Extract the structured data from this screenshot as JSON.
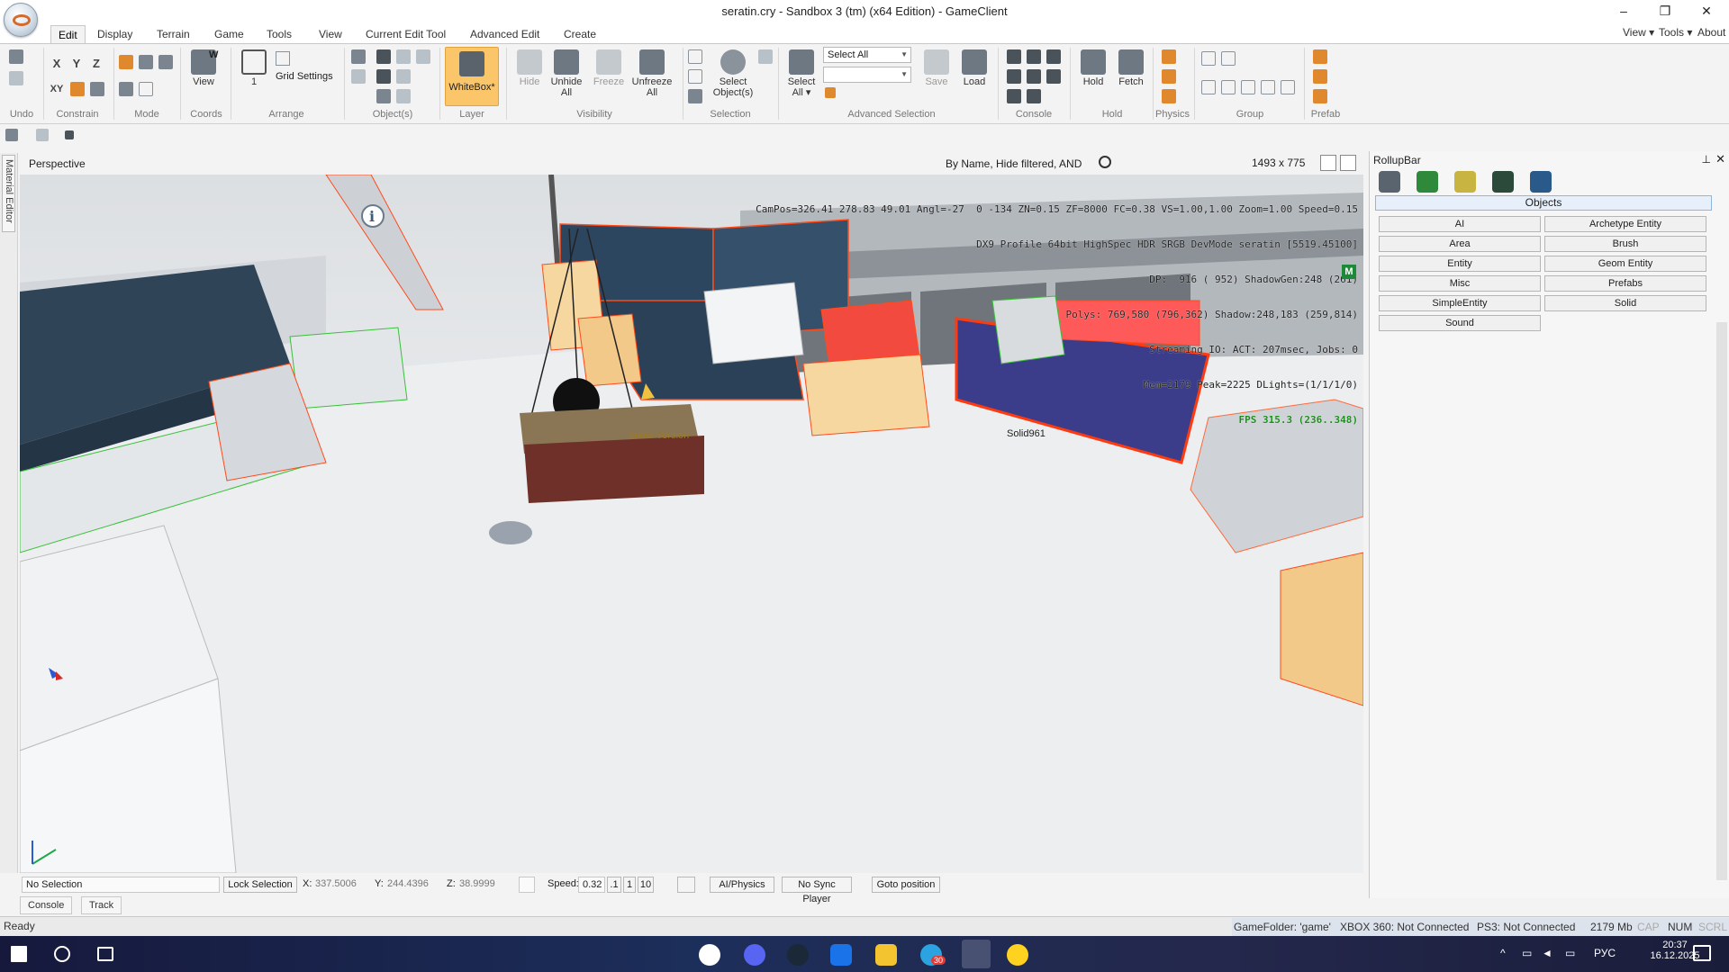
{
  "window": {
    "title": "seratin.cry - Sandbox 3 (tm) (x64 Edition) - GameClient",
    "controls": [
      "–",
      "❐",
      "✕"
    ]
  },
  "ribbon_tabs": [
    "Edit",
    "Display",
    "Terrain",
    "Game",
    "Tools",
    "View",
    "Current Edit Tool",
    "Advanced Edit",
    "Create"
  ],
  "active_tab": "Edit",
  "right_menus": [
    "View ▾",
    "Tools ▾",
    "About"
  ],
  "ribbon": {
    "groups": [
      "Undo",
      "Constrain",
      "Mode",
      "Coords",
      "Arrange",
      "Object(s)",
      "Layer",
      "Visibility",
      "Selection",
      "Advanced Selection",
      "Console",
      "Hold",
      "Physics",
      "Group",
      "Prefab"
    ],
    "axis_buttons": [
      "X",
      "Y",
      "Z",
      "XY"
    ],
    "coords_view": "View",
    "coords_letter": "W",
    "arrange_value": "1",
    "grid_settings": "Grid Settings",
    "whitebox": "WhiteBox*",
    "hide": "Hide",
    "unhide_all": [
      "Unhide",
      "All"
    ],
    "freeze": "Freeze",
    "unfreeze_all": [
      "Unfreeze",
      "All"
    ],
    "select_objects": [
      "Select",
      "Object(s)"
    ],
    "select_all_combo": "Select All",
    "select_all_btn": [
      "Select",
      "All ▾"
    ],
    "save": "Save",
    "load": "Load",
    "hold": "Hold",
    "fetch": "Fetch"
  },
  "viewport": {
    "name": "Perspective",
    "filter": "By Name, Hide filtered, AND",
    "resolution": "1493 x 775",
    "hud_lines": [
      "CamPos=326.41 278.83 49.01 Angl=-27  0 -134 ZN=0.15 ZF=8000 FC=0.38 VS=1.00,1.00 Zoom=1.00 Speed=0.15",
      "DX9 Profile 64bit HighSpec HDR SRGB DevMode seratin [5519.45100]",
      "DP:  916 ( 952) ShadowGen:248 (261)",
      "Polys: 769,580 (796,362) Shadow:248,183 (259,814)",
      "Streaming IO: ACT: 207msec, Jobs: 0",
      "Mem=2179 Peak=2225 DLights=(1/1/1/0)"
    ],
    "fps": "FPS 315.3 (236..348)",
    "m_badge": "M",
    "labels": {
      "solid": "Solid961",
      "snow": "Snow Version"
    }
  },
  "status_row": {
    "selection": "No Selection",
    "lock_selection": "Lock Selection",
    "x_label": "X:",
    "x_value": "337.5006",
    "y_label": "Y:",
    "y_value": "244.4396",
    "z_label": "Z:",
    "z_value": "38.9999",
    "speed_label": "Speed:",
    "speed_value": "0.32",
    "speed_presets": [
      ".1",
      "1",
      "10"
    ],
    "ai_physics": "AI/Physics",
    "no_sync_player": "No Sync Player",
    "goto_position": "Goto position"
  },
  "bottom_tabs": [
    "Console",
    "Track View"
  ],
  "side_tab": "Material Editor",
  "rollup": {
    "title": "RollupBar",
    "header": "Objects",
    "buttons_left": [
      "AI",
      "Area",
      "Entity",
      "Misc",
      "SimpleEntity",
      "Sound"
    ],
    "buttons_right": [
      "Archetype Entity",
      "Brush",
      "Geom Entity",
      "Prefabs",
      "Solid"
    ]
  },
  "status_bar": {
    "ready": "Ready",
    "game_folder": "GameFolder: 'game'",
    "xbox": "XBOX 360: Not Connected",
    "ps3": "PS3: Not Connected",
    "memory": "2179 Mb",
    "cap": "CAP",
    "num": "NUM",
    "scrl": "SCRL"
  },
  "taskbar": {
    "lang": "РУС",
    "time": "20:37",
    "date": "16.12.2025",
    "badge": "30"
  },
  "colors": {
    "accent_whitebox": "#fbc66a",
    "selection_orange": "#ff4a1a",
    "hud_fps_green": "#1b8f1b",
    "taskbar_dark": "#1c2e5a"
  }
}
